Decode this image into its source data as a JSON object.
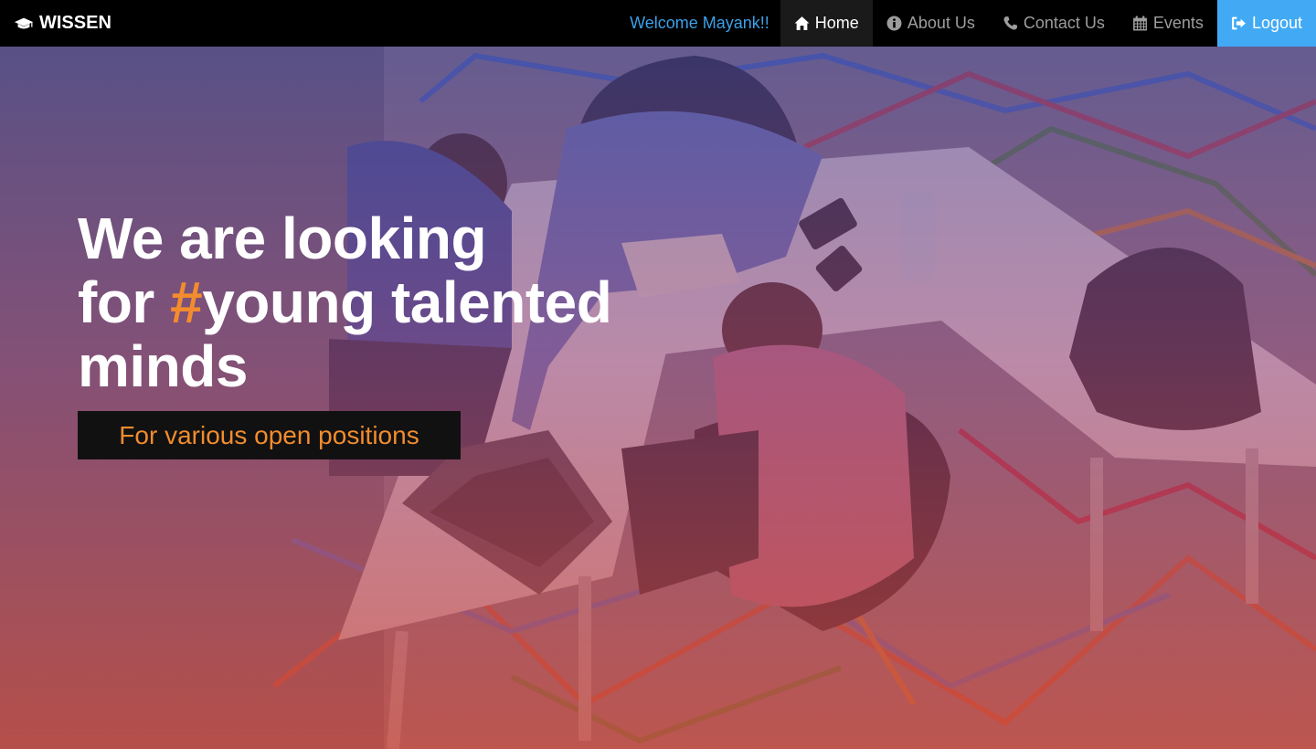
{
  "brand": {
    "name": "WISSEN",
    "icon": "graduation-cap-icon"
  },
  "nav": {
    "welcome": "Welcome Mayank!!",
    "items": [
      {
        "label": "Home",
        "icon": "home-icon",
        "active": true
      },
      {
        "label": "About Us",
        "icon": "info-circle-icon"
      },
      {
        "label": "Contact Us",
        "icon": "phone-icon"
      },
      {
        "label": "Events",
        "icon": "calendar-icon"
      },
      {
        "label": "Logout",
        "icon": "logout-icon"
      }
    ]
  },
  "hero": {
    "line1": "We are looking",
    "line2_prefix": "for ",
    "line2_hash": "#",
    "line2_rest": "young talented",
    "line3": "minds",
    "sub": "For various open positions"
  },
  "colors": {
    "accent": "#f28c2e",
    "welcome": "#3ba1e8",
    "logout_bg": "#42aaf5",
    "navbar_bg": "#000000"
  }
}
